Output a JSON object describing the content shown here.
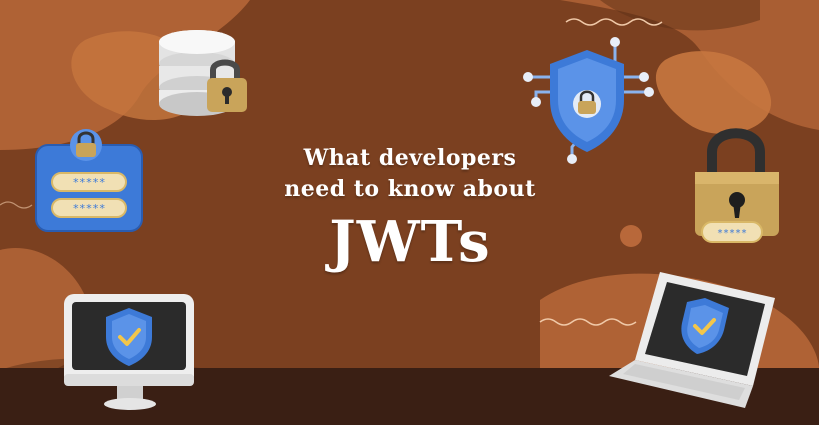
{
  "headline": {
    "line1": "What developers",
    "line2": "need to know about",
    "line3": "JWTs"
  },
  "password_mask": "*****",
  "colors": {
    "background": "#7b4020",
    "blob_light": "#b8683a",
    "blob_dark": "#5e2f16",
    "floor": "#3a1f14",
    "shield_blue": "#3d7ad8",
    "lock_gold": "#c9a45a",
    "check_yellow": "#f3c64a",
    "headline_text": "#ffffff"
  },
  "icons": [
    "database-lock-icon",
    "password-card-icon",
    "circuit-shield-icon",
    "padlock-password-icon",
    "monitor-shield-icon",
    "laptop-shield-icon"
  ]
}
